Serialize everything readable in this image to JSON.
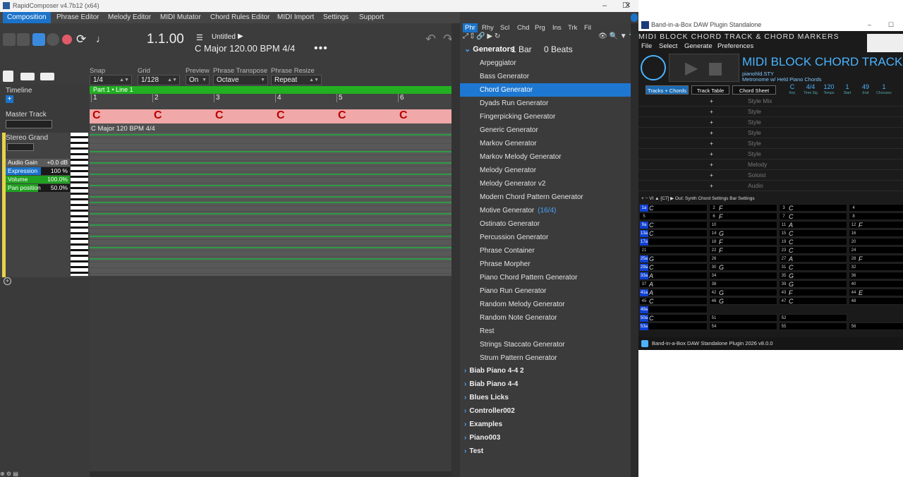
{
  "rc": {
    "window_title": "RapidComposer v4.7b12 (x64)",
    "menu": [
      "Composition",
      "Phrase Editor",
      "Melody Editor",
      "MIDI Mutator",
      "Chord Rules Editor",
      "MIDI Import",
      "Settings",
      "Support"
    ],
    "position": "1.1.00",
    "song_title": "Untitled",
    "song_info": "C Major   120.00 BPM   4/4",
    "more": "•••",
    "controls": {
      "snap_label": "Snap",
      "snap_value": "1/4",
      "grid_label": "Grid",
      "grid_value": "1/128",
      "preview_label": "Preview",
      "preview_value": "On",
      "transpose_label": "Phrase Transpose",
      "transpose_value": "Octave",
      "resize_label": "Phrase Resize",
      "resize_value": "Repeat"
    },
    "left": {
      "timeline": "Timeline",
      "master_track": "Master Track",
      "track_name": "Stereo Grand",
      "audio_gain_label": "Audio Gain",
      "audio_gain_value": "+0.0 dB",
      "expression_label": "Expression",
      "expression_value": "100 %",
      "volume_label": "Volume",
      "volume_value": "100.0%",
      "pan_label": "Pan position",
      "pan_value": "50.0%",
      "expression_level": 0.55,
      "volume_level": 1.0,
      "pan_level": 0.5
    },
    "part_label": "Part 1 • Line 1",
    "bars": [
      "1",
      "2",
      "3",
      "4",
      "5",
      "6"
    ],
    "chords": [
      "C",
      "C",
      "C",
      "C",
      "C",
      "C"
    ],
    "key_info": "C Major   120 BPM   4/4",
    "keys": [
      "Eb5",
      "Db5",
      "C5",
      "Bb4",
      "Ab4",
      "Gb4",
      "E4",
      "D4",
      "C4",
      "Bb3",
      "Ab3",
      "Gb3",
      "E3",
      "D3",
      "C3",
      "Bb2",
      "A2"
    ]
  },
  "browser": {
    "tabs": [
      "Phr",
      "Rhy",
      "Scl",
      "Chd",
      "Prg",
      "Ins",
      "Trk",
      "Fil"
    ],
    "header": "Generators",
    "bar": "1 Bar",
    "beats": "0 Beats",
    "items": [
      "Arpeggiator",
      "Bass Generator",
      "Chord Generator",
      "Dyads Run Generator",
      "Fingerpicking Generator",
      "Generic Generator",
      "Markov Generator",
      "Markov Melody Generator",
      "Melody Generator",
      "Melody Generator v2",
      "Modern Chord Pattern Generator",
      "Motive Generator",
      "Ostinato Generator",
      "Percussion Generator",
      "Phrase Container",
      "Phrase Morpher",
      "Piano Chord Pattern Generator",
      "Piano Run Generator",
      "Random Melody Generator",
      "Random Note Generator",
      "Rest",
      "Strings Staccato Generator",
      "Strum Pattern Generator"
    ],
    "motive_suffix": "(16/4)",
    "folders": [
      "Biab Piano 4-4 2",
      "Biab Piano 4-4",
      "Blues Licks",
      "Controller002",
      "Examples",
      "Piano003",
      "Test"
    ]
  },
  "biab": {
    "window_title": "Band-in-a-Box DAW Plugin Standalone",
    "header": "MIDI BLOCK CHORD TRACK & CHORD MARKERS",
    "menu": [
      "File",
      "Select",
      "Generate",
      "Preferences"
    ],
    "big_title": "MIDI BLOCK CHORD TRACK",
    "style_line1": "pianohld.STY",
    "style_line2": "Metronome w/ Held Piano Chords",
    "stats": [
      {
        "v": "C",
        "l": "Key"
      },
      {
        "v": "4/4",
        "l": "Time Sig"
      },
      {
        "v": "120",
        "l": "Tempo"
      },
      {
        "v": "1",
        "l": "Start"
      },
      {
        "v": "49",
        "l": "End"
      },
      {
        "v": "1",
        "l": "Choruses"
      }
    ],
    "tabs": [
      "Tracks + Chords",
      "Track Table",
      "Chord Sheet"
    ],
    "tracks": [
      "Style Mix",
      "Style",
      "Style",
      "Style",
      "Style",
      "Style",
      "Melody",
      "Soloist",
      "Audio"
    ],
    "toolbar": "+   −   VI   ▲   [C7]   ▶   Out: Synth   Chord Settings   Bar Settings",
    "rows": [
      [
        [
          "1a",
          "C"
        ],
        [
          "2",
          "F"
        ],
        [
          "3",
          "C"
        ],
        [
          "4",
          ""
        ]
      ],
      [
        [
          "5",
          ""
        ],
        [
          "6",
          "F"
        ],
        [
          "7",
          "C"
        ],
        [
          "8",
          ""
        ]
      ],
      [
        [
          "9a",
          "C"
        ],
        [
          "10",
          ""
        ],
        [
          "11",
          "A"
        ],
        [
          "12",
          "F"
        ]
      ],
      [
        [
          "13a",
          "C"
        ],
        [
          "14",
          "G"
        ],
        [
          "15",
          "C"
        ],
        [
          "16",
          ""
        ]
      ],
      [
        [
          "17a",
          ""
        ],
        [
          "18",
          "F"
        ],
        [
          "19",
          "C"
        ],
        [
          "20",
          ""
        ]
      ],
      [
        [
          "21",
          ""
        ],
        [
          "22",
          "F"
        ],
        [
          "23",
          "C"
        ],
        [
          "24",
          ""
        ]
      ],
      [
        [
          "25a",
          "G"
        ],
        [
          "26",
          ""
        ],
        [
          "27",
          "A"
        ],
        [
          "28",
          "F"
        ]
      ],
      [
        [
          "29a",
          "C"
        ],
        [
          "30",
          "G"
        ],
        [
          "31",
          "C"
        ],
        [
          "32",
          ""
        ]
      ],
      [
        [
          "33a",
          "A"
        ],
        [
          "34",
          ""
        ],
        [
          "35",
          "G"
        ],
        [
          "36",
          ""
        ]
      ],
      [
        [
          "37",
          "A"
        ],
        [
          "38",
          ""
        ],
        [
          "39",
          "G"
        ],
        [
          "40",
          ""
        ]
      ],
      [
        [
          "41a",
          "A"
        ],
        [
          "42",
          "G"
        ],
        [
          "43",
          "F"
        ],
        [
          "44",
          "E"
        ]
      ],
      [
        [
          "45",
          "C"
        ],
        [
          "46",
          "G"
        ],
        [
          "47",
          "C"
        ],
        [
          "48",
          ""
        ]
      ],
      [
        [
          "49a",
          ""
        ],
        [
          "",
          ""
        ],
        [
          "",
          ""
        ],
        [
          "",
          ""
        ]
      ],
      [
        [
          "50a",
          "C"
        ],
        [
          "51",
          ""
        ],
        [
          "52",
          ""
        ],
        [
          "",
          ""
        ]
      ],
      [
        [
          "53a",
          ""
        ],
        [
          "54",
          ""
        ],
        [
          "55",
          ""
        ],
        [
          "56",
          ""
        ]
      ]
    ],
    "status": "Band-in-a-Box DAW Standalone Plugin 2026 v8.0.0"
  },
  "colors": {
    "accent": "#1a73c9",
    "part": "#22b022",
    "chord_bg": "#f0a8a8",
    "biab_blue": "#4ab3ff"
  }
}
